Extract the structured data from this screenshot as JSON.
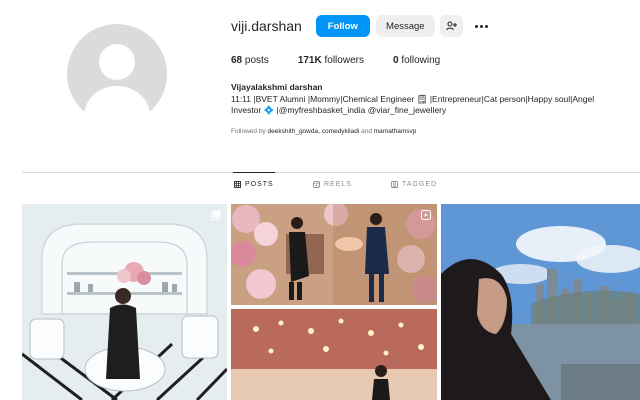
{
  "profile": {
    "username": "viji.darshan",
    "follow_label": "Follow",
    "message_label": "Message",
    "add_user_label": "+",
    "stats": {
      "posts_count": "68",
      "posts_label": "posts",
      "followers_count": "171K",
      "followers_label": "followers",
      "following_count": "0",
      "following_label": "following"
    },
    "full_name": "Vijayalakshmi darshan",
    "bio_line1": "11:11 |BVET Alumni |Mommy|Chemical Engineer 🗒 |Entrepreneur|Cat person|Happy soul|Angel",
    "bio_line2": "Investor 💠 |@myfreshbasket_india @viar_fine_jewellery",
    "followed_by_prefix": "Followed by",
    "followed_by_names": "deekshith_gowda, comedykiladi",
    "followed_by_and": "and",
    "followed_by_last": "mamathamsvp"
  },
  "tabs": [
    {
      "label": "POSTS",
      "icon": "grid-icon",
      "active": true
    },
    {
      "label": "REELS",
      "icon": "reels-icon",
      "active": false
    },
    {
      "label": "TAGGED",
      "icon": "tag-icon",
      "active": false
    }
  ],
  "colors": {
    "accent": "#0095f6",
    "button_bg": "#efefef",
    "divider": "#dbdbdb"
  }
}
